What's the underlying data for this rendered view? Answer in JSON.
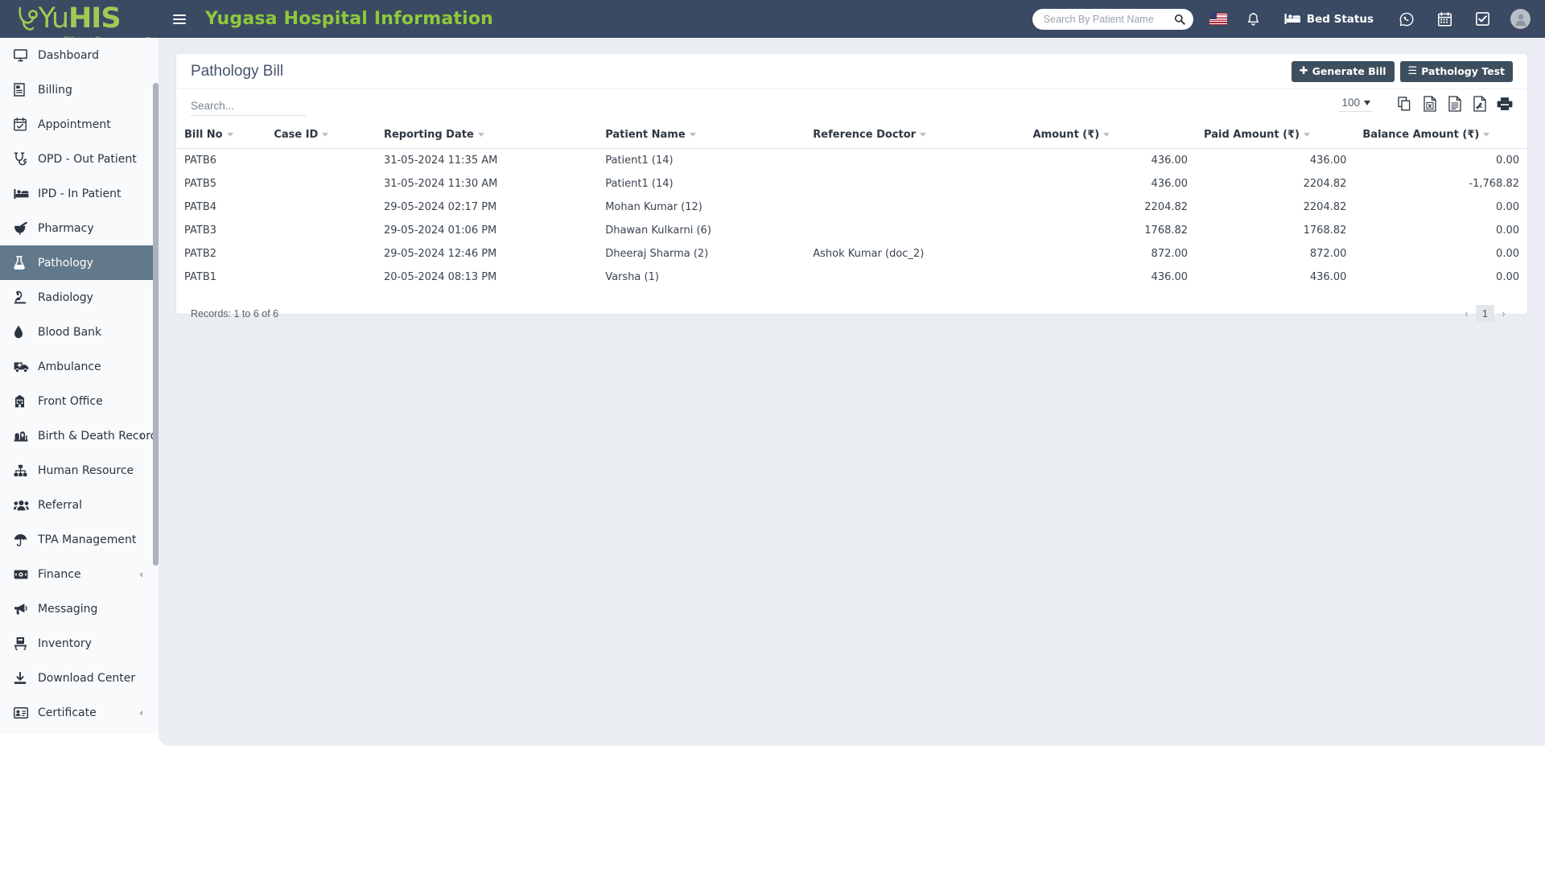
{
  "topbar": {
    "logo_main": "Yu",
    "logo_bold": "HIS",
    "logo_tagline": "Efficient Care",
    "app_title": "Yugasa Hospital Information",
    "search_placeholder": "Search By Patient Name",
    "search_value": "",
    "bed_status_label": "Bed Status",
    "icons": {
      "hamburger": "hamburger-icon",
      "search": "search-icon",
      "flag": "us-flag-icon",
      "bell": "bell-icon",
      "bed": "bed-icon",
      "whatsapp": "whatsapp-icon",
      "calendar": "calendar-icon",
      "task": "check-square-icon",
      "avatar": "user-avatar"
    }
  },
  "sidebar": {
    "items": [
      {
        "label": "Dashboard",
        "icon": "desktop-icon",
        "active": false,
        "chevron": ""
      },
      {
        "label": "Billing",
        "icon": "receipt-icon",
        "active": false,
        "chevron": ""
      },
      {
        "label": "Appointment",
        "icon": "calendar-check-icon",
        "active": false,
        "chevron": ""
      },
      {
        "label": "OPD - Out Patient",
        "icon": "stethoscope-icon",
        "active": false,
        "chevron": ""
      },
      {
        "label": "IPD - In Patient",
        "icon": "hospital-bed-icon",
        "active": false,
        "chevron": ""
      },
      {
        "label": "Pharmacy",
        "icon": "mortar-pestle-icon",
        "active": false,
        "chevron": ""
      },
      {
        "label": "Pathology",
        "icon": "flask-icon",
        "active": true,
        "chevron": ""
      },
      {
        "label": "Radiology",
        "icon": "microscope-icon",
        "active": false,
        "chevron": ""
      },
      {
        "label": "Blood Bank",
        "icon": "blood-drop-icon",
        "active": false,
        "chevron": ""
      },
      {
        "label": "Ambulance",
        "icon": "ambulance-icon",
        "active": false,
        "chevron": ""
      },
      {
        "label": "Front Office",
        "icon": "building-icon",
        "active": false,
        "chevron": ""
      },
      {
        "label": "Birth & Death Record",
        "icon": "cemetery-icon",
        "active": false,
        "chevron": "‹"
      },
      {
        "label": "Human Resource",
        "icon": "sitemap-icon",
        "active": false,
        "chevron": ""
      },
      {
        "label": "Referral",
        "icon": "users-icon",
        "active": false,
        "chevron": ""
      },
      {
        "label": "TPA Management",
        "icon": "umbrella-icon",
        "active": false,
        "chevron": ""
      },
      {
        "label": "Finance",
        "icon": "money-bill-icon",
        "active": false,
        "chevron": "‹"
      },
      {
        "label": "Messaging",
        "icon": "megaphone-icon",
        "active": false,
        "chevron": ""
      },
      {
        "label": "Inventory",
        "icon": "warehouse-icon",
        "active": false,
        "chevron": ""
      },
      {
        "label": "Download Center",
        "icon": "download-icon",
        "active": false,
        "chevron": ""
      },
      {
        "label": "Certificate",
        "icon": "id-card-icon",
        "active": false,
        "chevron": "‹"
      }
    ]
  },
  "page": {
    "title": "Pathology Bill",
    "generate_bill_label": "Generate Bill",
    "generate_bill_glyph": "✚",
    "pathology_test_label": "Pathology Test",
    "pathology_test_glyph": "☰"
  },
  "toolbar": {
    "search_placeholder": "Search...",
    "search_value": "",
    "page_length": "100",
    "export_icons": [
      {
        "name": "copy-icon",
        "title": "Copy"
      },
      {
        "name": "excel-icon",
        "title": "Excel"
      },
      {
        "name": "csv-icon",
        "title": "CSV"
      },
      {
        "name": "pdf-icon",
        "title": "PDF"
      },
      {
        "name": "print-icon",
        "title": "Print"
      }
    ]
  },
  "table": {
    "columns": [
      {
        "label": "Bill No",
        "align": "left",
        "sortable": true
      },
      {
        "label": "Case ID",
        "align": "left",
        "sortable": true
      },
      {
        "label": "Reporting Date",
        "align": "left",
        "sortable": true
      },
      {
        "label": "Patient Name",
        "align": "left",
        "sortable": true
      },
      {
        "label": "Reference Doctor",
        "align": "left",
        "sortable": true
      },
      {
        "label": "Amount (₹)",
        "align": "right",
        "sortable": true
      },
      {
        "label": "Paid Amount (₹)",
        "align": "right",
        "sortable": true
      },
      {
        "label": "Balance Amount (₹)",
        "align": "right",
        "sortable": true
      }
    ],
    "rows": [
      {
        "bill_no": "PATB6",
        "case_id": "",
        "reporting_date": "31-05-2024 11:35 AM",
        "patient_name": "Patient1 (14)",
        "reference_doctor": "",
        "amount": "436.00",
        "paid_amount": "436.00",
        "balance_amount": "0.00"
      },
      {
        "bill_no": "PATB5",
        "case_id": "",
        "reporting_date": "31-05-2024 11:30 AM",
        "patient_name": "Patient1 (14)",
        "reference_doctor": "",
        "amount": "436.00",
        "paid_amount": "2204.82",
        "balance_amount": "-1,768.82"
      },
      {
        "bill_no": "PATB4",
        "case_id": "",
        "reporting_date": "29-05-2024 02:17 PM",
        "patient_name": "Mohan Kumar (12)",
        "reference_doctor": "",
        "amount": "2204.82",
        "paid_amount": "2204.82",
        "balance_amount": "0.00"
      },
      {
        "bill_no": "PATB3",
        "case_id": "",
        "reporting_date": "29-05-2024 01:06 PM",
        "patient_name": "Dhawan Kulkarni (6)",
        "reference_doctor": "",
        "amount": "1768.82",
        "paid_amount": "1768.82",
        "balance_amount": "0.00"
      },
      {
        "bill_no": "PATB2",
        "case_id": "",
        "reporting_date": "29-05-2024 12:46 PM",
        "patient_name": "Dheeraj Sharma (2)",
        "reference_doctor": "Ashok Kumar (doc_2)",
        "amount": "872.00",
        "paid_amount": "872.00",
        "balance_amount": "0.00"
      },
      {
        "bill_no": "PATB1",
        "case_id": "",
        "reporting_date": "20-05-2024 08:13 PM",
        "patient_name": "Varsha (1)",
        "reference_doctor": "",
        "amount": "436.00",
        "paid_amount": "436.00",
        "balance_amount": "0.00"
      }
    ]
  },
  "footer": {
    "records_info": "Records: 1 to 6 of 6",
    "pager": {
      "prev": "‹",
      "pages": [
        "1"
      ],
      "next": "›"
    }
  },
  "colors": {
    "topbar_bg": "#3a4a63",
    "brand_green": "#8fc93a",
    "sidebar_bg": "#f8fafb",
    "active_nav_bg": "#61798a",
    "content_bg": "#eaedf1",
    "button_bg": "#3d4f5e",
    "title_color": "#44546a"
  }
}
